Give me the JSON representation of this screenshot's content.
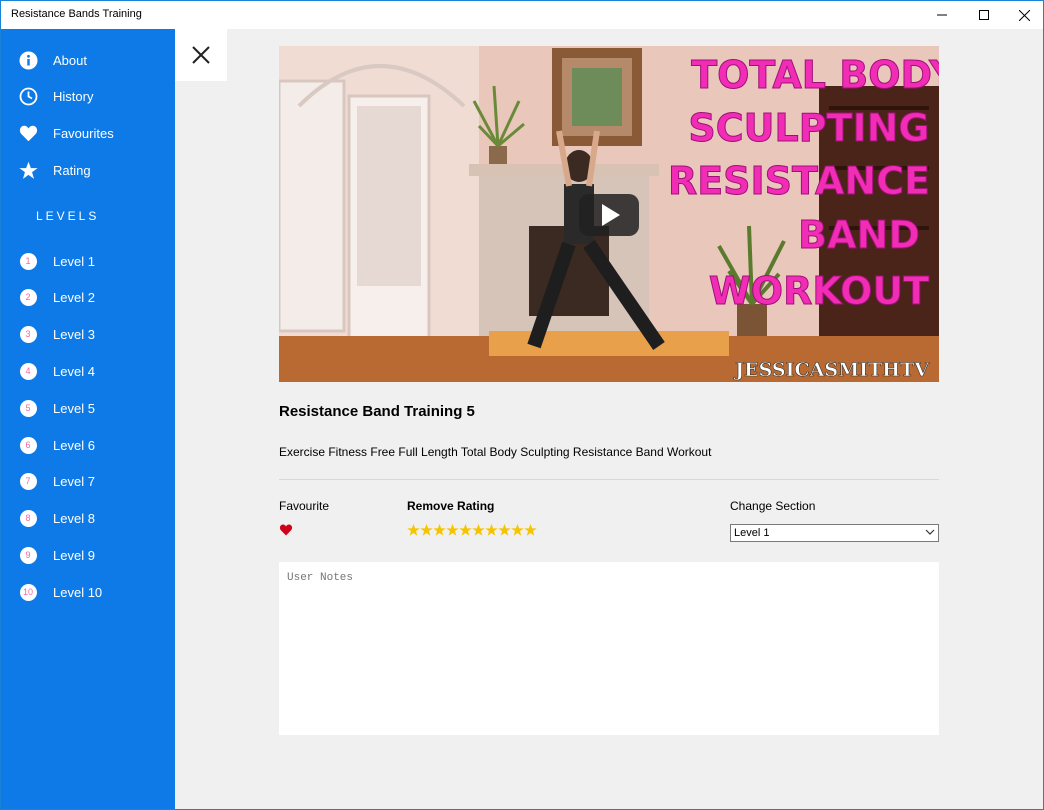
{
  "window": {
    "title": "Resistance Bands Training"
  },
  "sidebar": {
    "items": [
      {
        "label": "About",
        "icon": "info-icon"
      },
      {
        "label": "History",
        "icon": "clock-icon"
      },
      {
        "label": "Favourites",
        "icon": "heart-icon"
      },
      {
        "label": "Rating",
        "icon": "star-icon"
      }
    ],
    "levels_heading": "LEVELS",
    "levels": [
      {
        "num": "1",
        "label": "Level 1"
      },
      {
        "num": "2",
        "label": "Level 2"
      },
      {
        "num": "3",
        "label": "Level 3"
      },
      {
        "num": "4",
        "label": "Level 4"
      },
      {
        "num": "5",
        "label": "Level 5"
      },
      {
        "num": "6",
        "label": "Level 6"
      },
      {
        "num": "7",
        "label": "Level 7"
      },
      {
        "num": "8",
        "label": "Level 8"
      },
      {
        "num": "9",
        "label": "Level 9"
      },
      {
        "num": "10",
        "label": "Level 10"
      }
    ]
  },
  "video": {
    "overlay_lines": [
      "TOTAL BODY",
      "SCULPTING",
      "RESISTANCE",
      "BAND",
      "WORKOUT"
    ],
    "channel": "JESSICASMITHTV"
  },
  "detail": {
    "title": "Resistance Band Training 5",
    "description": "Exercise Fitness Free Full Length Total Body Sculpting Resistance Band Workout",
    "favourite_label": "Favourite",
    "rating_label": "Remove Rating",
    "rating_stars": 10,
    "section_label": "Change Section",
    "section_value": "Level 1",
    "notes_placeholder": "User Notes"
  },
  "colors": {
    "sidebar": "#0d7ae8",
    "accent_pink": "#f02db4",
    "star": "#f5c400",
    "heart": "#d0021b"
  }
}
